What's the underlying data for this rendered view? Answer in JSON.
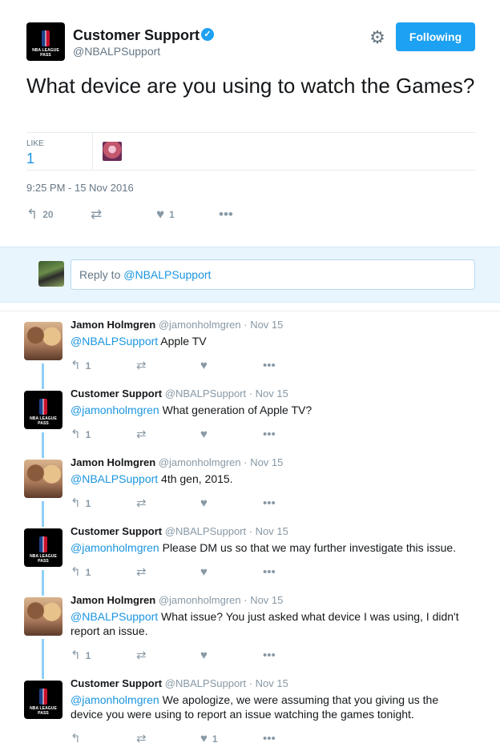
{
  "tweet": {
    "author_name": "Customer Support",
    "author_handle": "@NBALPSupport",
    "avatar_text": "NBA LEAGUE PASS",
    "follow_label": "Following",
    "text": "What device are you using to watch the Games?",
    "likes_label": "LIKE",
    "likes_count": "1",
    "timestamp": "9:25 PM - 15 Nov 2016",
    "reply_count": "20",
    "like_count_action": "1"
  },
  "reply_box": {
    "prefix": "Reply to ",
    "mention": "@NBALPSupport"
  },
  "conversation": [
    {
      "name": "Jamon Holmgren",
      "handle": "@jamonholmgren",
      "date": "Nov 15",
      "mention": "@NBALPSupport",
      "text": " Apple TV",
      "replies": "1",
      "likes": ""
    },
    {
      "name": "Customer Support",
      "handle": "@NBALPSupport",
      "date": "Nov 15",
      "mention": "@jamonholmgren",
      "text": " What generation of Apple TV?",
      "replies": "1",
      "likes": ""
    },
    {
      "name": "Jamon Holmgren",
      "handle": "@jamonholmgren",
      "date": "Nov 15",
      "mention": "@NBALPSupport",
      "text": " 4th gen, 2015.",
      "replies": "1",
      "likes": ""
    },
    {
      "name": "Customer Support",
      "handle": "@NBALPSupport",
      "date": "Nov 15",
      "mention": "@jamonholmgren",
      "text": " Please DM us so that we may further investigate this issue.",
      "replies": "1",
      "likes": ""
    },
    {
      "name": "Jamon Holmgren",
      "handle": "@jamonholmgren",
      "date": "Nov 15",
      "mention": "@NBALPSupport",
      "text": " What issue? You just asked what device I was using, I didn't report an issue.",
      "replies": "1",
      "likes": ""
    },
    {
      "name": "Customer Support",
      "handle": "@NBALPSupport",
      "date": "Nov 15",
      "mention": "@jamonholmgren",
      "text": " We apologize,  we were assuming that you giving us the device you were using to report an issue watching the games tonight.",
      "replies": "",
      "likes": "1"
    }
  ],
  "colors": {
    "accent": "#1da1f2",
    "link": "#1b95e0",
    "muted": "#657786",
    "thread_line": "#8dcff6"
  },
  "icons": {
    "reply": "reply-icon",
    "retweet": "retweet-icon",
    "like": "heart-icon",
    "more": "more-icon",
    "settings": "gear-icon",
    "verified": "verified-badge-icon"
  }
}
